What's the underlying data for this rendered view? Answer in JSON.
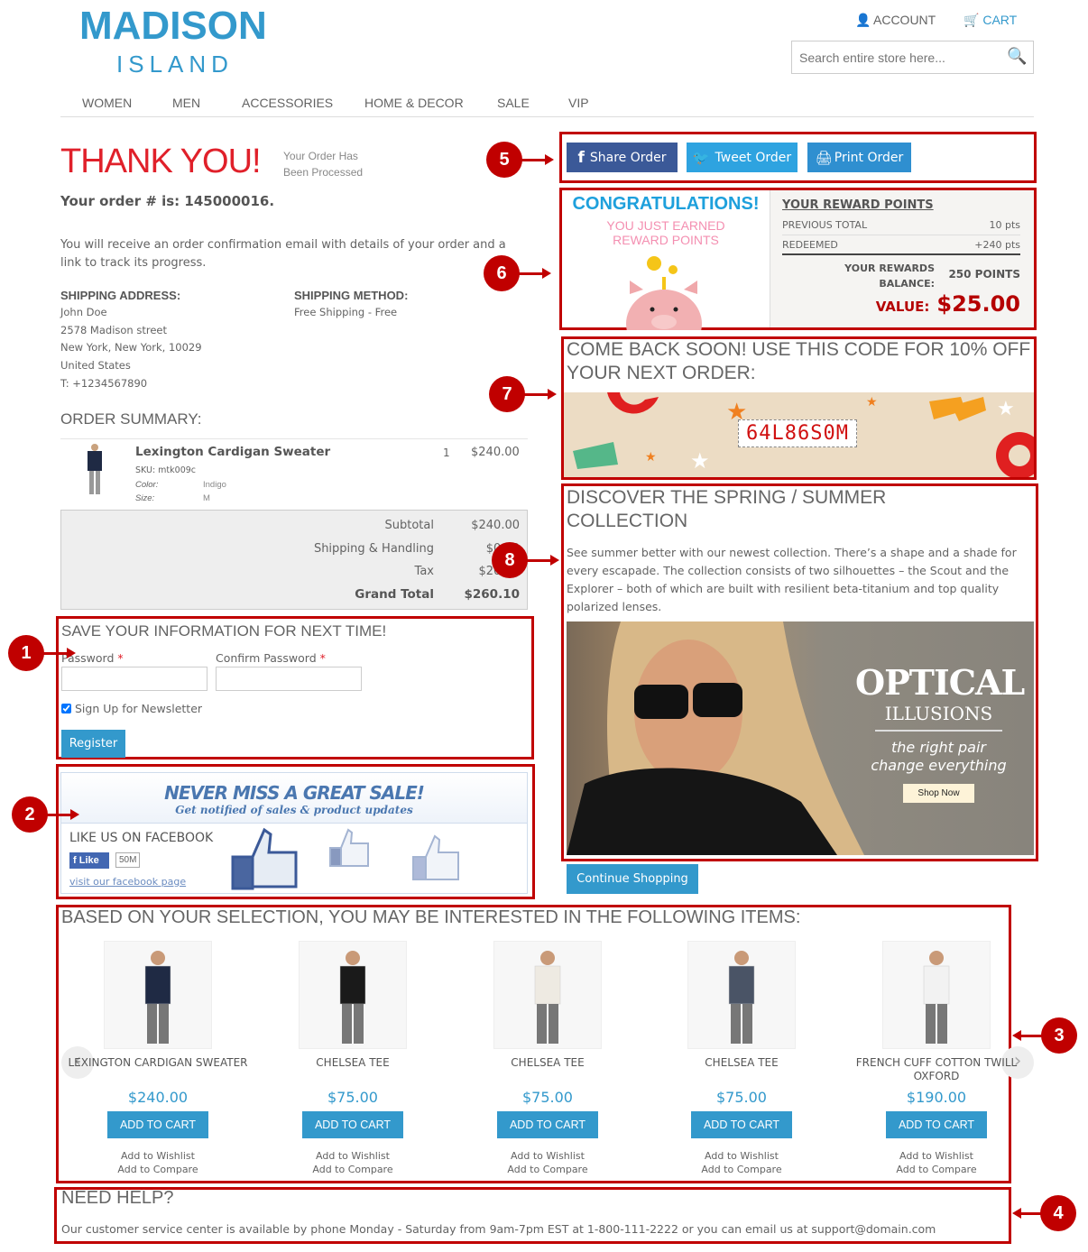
{
  "header": {
    "logo_line1": "MADISON",
    "logo_line2": "ISLAND",
    "account": "ACCOUNT",
    "cart": "CART",
    "search_placeholder": "Search entire store here..."
  },
  "nav": [
    "WOMEN",
    "MEN",
    "ACCESSORIES",
    "HOME & DECOR",
    "SALE",
    "VIP"
  ],
  "order": {
    "thank_you": "THANK YOU!",
    "subtitle_line1": "Your Order Has",
    "subtitle_line2": "Been Processed",
    "order_number": "Your order # is: 145000016.",
    "message": "You will receive an order confirmation email with details of your order and a link to track its progress.",
    "shipping_address_label": "SHIPPING ADDRESS:",
    "address": [
      "John Doe",
      "2578 Madison street",
      "New York, New York, 10029",
      "United States",
      "T: +1234567890"
    ],
    "shipping_method_label": "SHIPPING METHOD:",
    "shipping_method": "Free Shipping - Free"
  },
  "summary": {
    "title": "ORDER SUMMARY:",
    "item": {
      "name": "Lexington Cardigan Sweater",
      "sku": "SKU: mtk009c",
      "color_label": "Color:",
      "color": "Indigo",
      "size_label": "Size:",
      "size": "M",
      "qty": "1",
      "price": "$240.00"
    },
    "totals": [
      {
        "label": "Subtotal",
        "value": "$240.00"
      },
      {
        "label": "Shipping & Handling",
        "value": "$0.00"
      },
      {
        "label": "Tax",
        "value": "$20.10"
      },
      {
        "label": "Grand Total",
        "value": "$260.10"
      }
    ]
  },
  "register": {
    "title": "SAVE YOUR INFORMATION FOR NEXT TIME!",
    "password_label": "Password",
    "confirm_label": "Confirm Password",
    "required": "*",
    "newsletter": "Sign Up for Newsletter",
    "newsletter_checked": true,
    "button": "Register"
  },
  "facebook": {
    "headline": "NEVER MISS A GREAT SALE!",
    "subhead": "Get notified of  sales & product updates",
    "like_us": "LIKE US ON FACEBOOK",
    "like": "Like",
    "count": "50M",
    "link": "visit our facebook page"
  },
  "share": {
    "share": "Share Order",
    "tweet": "Tweet Order",
    "print": "Print Order"
  },
  "rewards": {
    "congrats": "CONGRATULATIONS!",
    "earned_line1": "YOU JUST EARNED",
    "earned_line2": "REWARD POINTS",
    "title": "YOUR REWARD POINTS",
    "previous_label": "PREVIOUS TOTAL",
    "previous": "10 pts",
    "redeemed_label": "REDEEMED",
    "redeemed": "+240 pts",
    "balance_label": "YOUR REWARDS BALANCE:",
    "balance": "250 POINTS",
    "value_label": "VALUE:",
    "value": "$25.00"
  },
  "coupon": {
    "title": "COME BACK SOON! USE THIS CODE FOR 10% OFF YOUR NEXT ORDER:",
    "code": "64L86S0M"
  },
  "collection": {
    "title": "DISCOVER THE SPRING / SUMMER COLLECTION",
    "text": "See summer better with our newest collection. There’s a shape and a shade for every escapade. The collection consists of two silhouettes – the Scout and the Explorer – both of which are built with resilient beta-titanium and top quality polarized lenses.",
    "banner_title": "OPTICAL",
    "banner_sub": "ILLUSIONS",
    "banner_tag1": "the right pair",
    "banner_tag2": "change everything",
    "banner_button": "Shop Now"
  },
  "continue": "Continue Shopping",
  "upsell": {
    "title": "BASED ON YOUR SELECTION, YOU MAY BE INTERESTED IN THE FOLLOWING ITEMS:",
    "add_to_cart": "ADD TO CART",
    "wishlist": "Add to Wishlist",
    "compare": "Add to Compare",
    "items": [
      {
        "name": "LEXINGTON CARDIGAN SWEATER",
        "price": "$240.00",
        "color": "#1f2a44"
      },
      {
        "name": "CHELSEA TEE",
        "price": "$75.00",
        "color": "#1a1a1a"
      },
      {
        "name": "CHELSEA TEE",
        "price": "$75.00",
        "color": "#eeeae2"
      },
      {
        "name": "CHELSEA TEE",
        "price": "$75.00",
        "color": "#4a5466"
      },
      {
        "name": "FRENCH CUFF COTTON TWILL OXFORD",
        "price": "$190.00",
        "color": "#f2f2f2"
      }
    ]
  },
  "help": {
    "title": "NEED HELP?",
    "text": "Our customer service center is available by phone Monday - Saturday from 9am-7pm EST at 1-800-111-2222 or you can email us at support@domain.com"
  },
  "callouts": [
    "1",
    "2",
    "3",
    "4",
    "5",
    "6",
    "7",
    "8"
  ],
  "colors": {
    "accent": "#3399cc",
    "callout": "#c00000",
    "thank_you": "#e0202a",
    "facebook": "#3b5998"
  }
}
